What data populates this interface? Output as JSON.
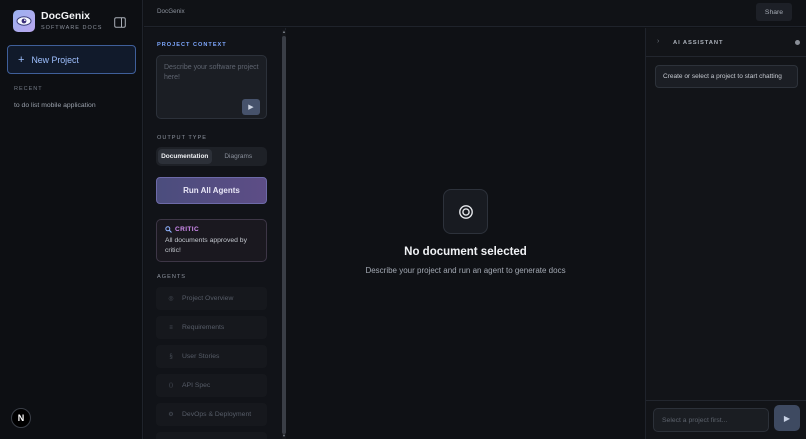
{
  "app": {
    "name": "DocGenix",
    "subtitle": "SOFTWARE DOCS",
    "logo_icon": "eye-icon"
  },
  "sidebar": {
    "new_project_label": "New Project",
    "recent_label": "RECENT",
    "recent_items": [
      "to do list mobile application"
    ],
    "avatar_letter": "N"
  },
  "header": {
    "breadcrumb": "DocGenix",
    "share_label": "Share"
  },
  "context_panel": {
    "project_context_label": "PROJECT CONTEXT",
    "textarea_placeholder": "Describe your software project here!",
    "output_type_label": "OUTPUT TYPE",
    "output_types": [
      {
        "label": "Documentation",
        "active": true
      },
      {
        "label": "Diagrams",
        "active": false
      }
    ],
    "run_all_label": "Run All Agents",
    "critic": {
      "title": "CRITIC",
      "message": "All documents approved by critic!"
    },
    "agents_label": "AGENTS",
    "agents": [
      {
        "label": "Project Overview",
        "icon": "◎"
      },
      {
        "label": "Requirements",
        "icon": "≡"
      },
      {
        "label": "User Stories",
        "icon": "§"
      },
      {
        "label": "API Spec",
        "icon": "⟨⟩"
      },
      {
        "label": "DevOps & Deployment",
        "icon": "⚙"
      }
    ]
  },
  "main": {
    "empty_title": "No document selected",
    "empty_subtitle": "Describe your project and run an agent to generate docs"
  },
  "assistant": {
    "title": "AI ASSISTANT",
    "message": "Create or select a project to start chatting",
    "input_placeholder": "Select a project first..."
  },
  "colors": {
    "accent": "#7ea8ff",
    "critic": "#d28df2",
    "run_button": "#5d4d86"
  }
}
